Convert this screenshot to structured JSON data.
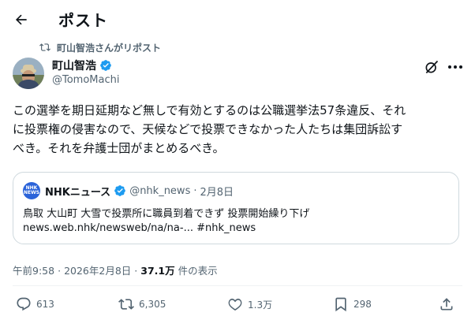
{
  "header": {
    "title": "ポスト",
    "back_icon": "arrow-left-icon"
  },
  "repost": {
    "label": "町山智浩さんがリポスト",
    "icon": "repost-icon"
  },
  "author": {
    "name": "町山智浩",
    "handle": "@TomoMachi",
    "verified_color": "#1d9bf0"
  },
  "tweet": {
    "lines": [
      "この選挙を期日延期など無しで有効とするのは公職選挙法57条違反、それ",
      "に投票権の侵害なので、天候などで投票できなかった人たちは集団訴訟す",
      "べき。それを弁護士団がまとめるべき。"
    ]
  },
  "quote": {
    "logo_text": "NHK NEWS",
    "name": "NHKニュース",
    "handle": "@nhk_news",
    "separator": "·",
    "date": "2月8日",
    "line1": "鳥取 大山町 大雪で投票所に職員到着できず 投票開始繰り下げ",
    "line2": "news.web.nhk/newsweb/na/na-... #nhk_news",
    "logo_color": "#2b63d9"
  },
  "meta": {
    "time": "午前9:58",
    "separator1": "·",
    "date": "2026年2月8日",
    "separator2": "·",
    "views": "37.1万",
    "views_label": "件の表示"
  },
  "actions": {
    "reply_count": "613",
    "repost_count": "6,305",
    "like_count": "1.3万",
    "bookmark_count": "298"
  },
  "colors": {
    "secondary_text": "#536471",
    "border": "#cfd9de",
    "text": "#0f1419"
  }
}
